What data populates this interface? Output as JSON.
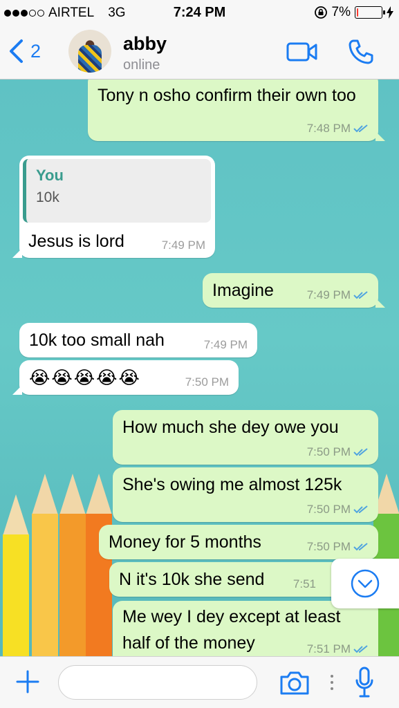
{
  "status_bar": {
    "carrier": "AIRTEL",
    "network": "3G",
    "time": "7:24 PM",
    "battery_percent": "7%",
    "battery_level": 0.07,
    "signal_bars_filled": 3,
    "signal_bars_total": 5
  },
  "header": {
    "back_count": "2",
    "contact_name": "abby",
    "contact_status": "online",
    "accent_color": "#1b7cf2"
  },
  "messages": [
    {
      "dir": "out",
      "text": "Tony n osho confirm their own too",
      "time": "7:48 PM",
      "read": true
    },
    {
      "dir": "in",
      "quote_author": "You",
      "quote_text": "10k",
      "text": "Jesus is lord",
      "time": "7:49 PM"
    },
    {
      "dir": "out",
      "text": "Imagine",
      "time": "7:49 PM",
      "read": true
    },
    {
      "dir": "in",
      "text": "10k too small nah",
      "time": "7:49 PM"
    },
    {
      "dir": "in",
      "text": "😭😭😭😭😭",
      "time": "7:50 PM"
    },
    {
      "dir": "out",
      "text": "How much she dey owe you",
      "time": "7:50 PM",
      "read": true
    },
    {
      "dir": "out",
      "text": "She's owing me almost 125k",
      "time": "7:50 PM",
      "read": true
    },
    {
      "dir": "out",
      "text": "Money for 5 months",
      "time": "7:50 PM",
      "read": true
    },
    {
      "dir": "out",
      "text": "N it's 10k she send",
      "time": "7:51",
      "read": true
    },
    {
      "dir": "out",
      "text": "Me wey I dey except at least half of the money",
      "time": "7:51 PM",
      "read": true
    }
  ],
  "input": {
    "placeholder": ""
  },
  "colors": {
    "outgoing_bubble": "#dcf8c6",
    "incoming_bubble": "#ffffff",
    "read_ticks": "#4fa3e0",
    "quote_accent": "#3a9c8e"
  }
}
